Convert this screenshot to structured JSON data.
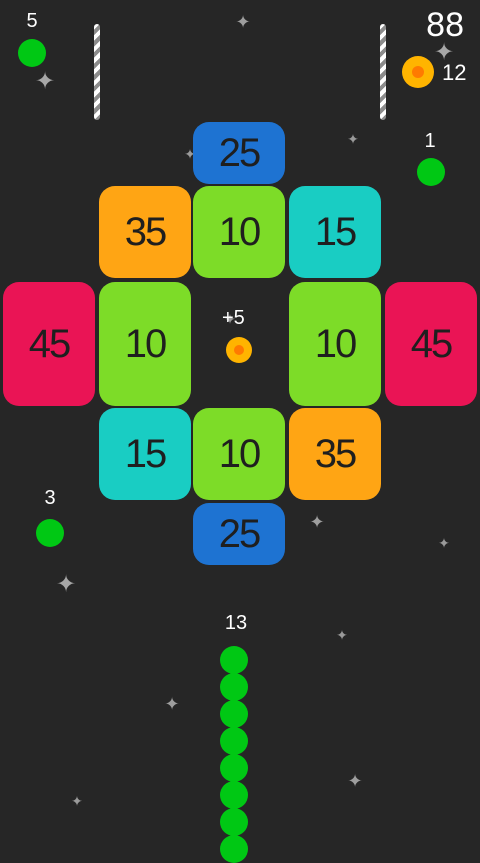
{
  "hud": {
    "score": "88",
    "coins": "12"
  },
  "colors": {
    "background": "#262626",
    "blue": "#1e73d2",
    "orange": "#ffa514",
    "lime": "#7ddc28",
    "cyan": "#19cdc3",
    "red": "#ea1455",
    "green_ball": "#00c814",
    "coin_outer": "#ffb400",
    "coin_inner": "#ff7a00"
  },
  "blocks": {
    "top_center": "25",
    "row1_left": "35",
    "row1_center": "10",
    "row1_right": "15",
    "mid_far_left": "45",
    "mid_left": "10",
    "mid_right": "10",
    "mid_far_right": "45",
    "row3_left": "15",
    "row3_center": "10",
    "row3_right": "35",
    "bottom_center": "25"
  },
  "pickups": {
    "top_left": "5",
    "right": "1",
    "left": "3",
    "coin_bonus": "+5"
  },
  "snake": {
    "length": "13",
    "visible_segments": 8
  }
}
